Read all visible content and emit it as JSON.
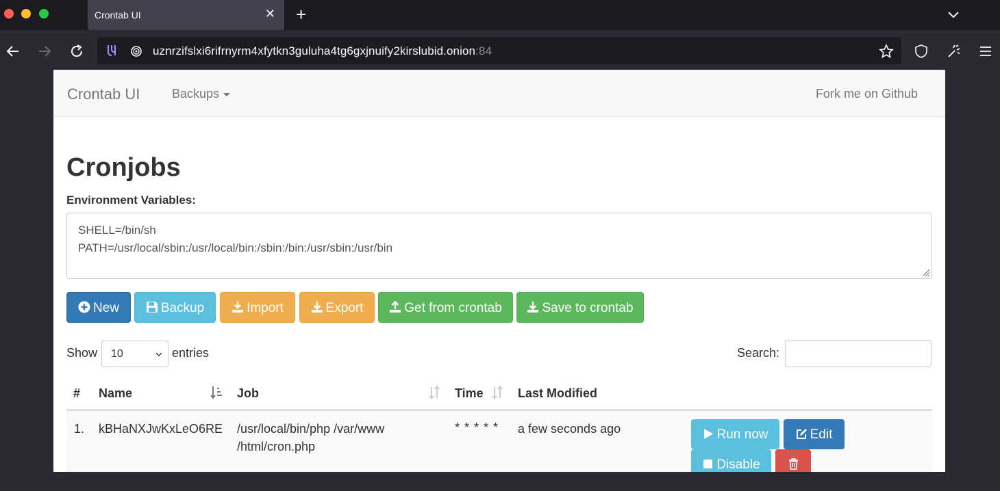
{
  "browser": {
    "tab_title": "Crontab UI",
    "url_host": "uznrzifslxi6rifrnyrm4xfytkn3guluha4tg6gxjnuify2kirslubid.onion",
    "url_port": ":84"
  },
  "navbar": {
    "brand": "Crontab UI",
    "backups": "Backups",
    "fork": "Fork me on Github"
  },
  "main": {
    "title": "Cronjobs",
    "env_label": "Environment Variables:",
    "env_lines": [
      "SHELL=/bin/sh",
      "PATH=/usr/local/sbin:/usr/local/bin:/sbin:/bin:/usr/sbin:/usr/bin"
    ]
  },
  "toolbar": {
    "new": "New",
    "backup": "Backup",
    "import": "Import",
    "export": "Export",
    "get": "Get from crontab",
    "save": "Save to crontab"
  },
  "table_controls": {
    "show": "Show",
    "page_size": "10",
    "entries": "entries",
    "search": "Search:"
  },
  "table": {
    "headers": [
      "#",
      "Name",
      "Job",
      "Time",
      "Last Modified"
    ],
    "rows": [
      {
        "index": "1.",
        "name": "kBHaNXJwKxLeO6RE",
        "job_line1": "/usr/local/bin/php /var/www",
        "job_line2": "/html/cron.php",
        "time": "* * * * *",
        "modified": "a few seconds ago",
        "run": "Run now",
        "edit": "Edit",
        "disable": "Disable"
      }
    ]
  },
  "colors": {
    "primary": "#337ab7",
    "info": "#5bc0de",
    "warning": "#f0ad4e",
    "success": "#5cb85c",
    "danger": "#d9534f"
  }
}
